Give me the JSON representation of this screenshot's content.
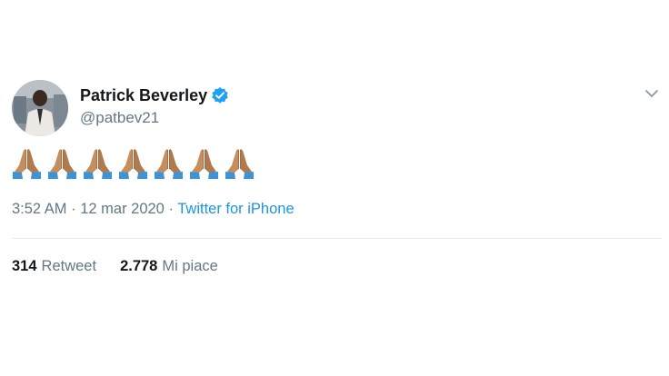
{
  "user": {
    "display_name": "Patrick Beverley",
    "handle": "@patbev21",
    "verified": true
  },
  "tweet": {
    "content_emoji": "🙏🏽🙏🏽🙏🏽🙏🏽🙏🏽🙏🏽🙏🏽",
    "emoji_count": 7,
    "emoji_icon": "folded-hands-icon"
  },
  "meta": {
    "time": "3:52 AM",
    "separator": " · ",
    "date": "12 mar 2020",
    "source": "Twitter for iPhone"
  },
  "stats": {
    "retweets_count": "314",
    "retweets_label": "Retweet",
    "likes_count": "2.778",
    "likes_label": "Mi piace"
  },
  "colors": {
    "name": "#14171a",
    "secondary": "#657786",
    "link": "#1b95e0",
    "verified": "#1da1f2",
    "skin": "#c68e5d",
    "sleeve": "#3b94d9"
  }
}
